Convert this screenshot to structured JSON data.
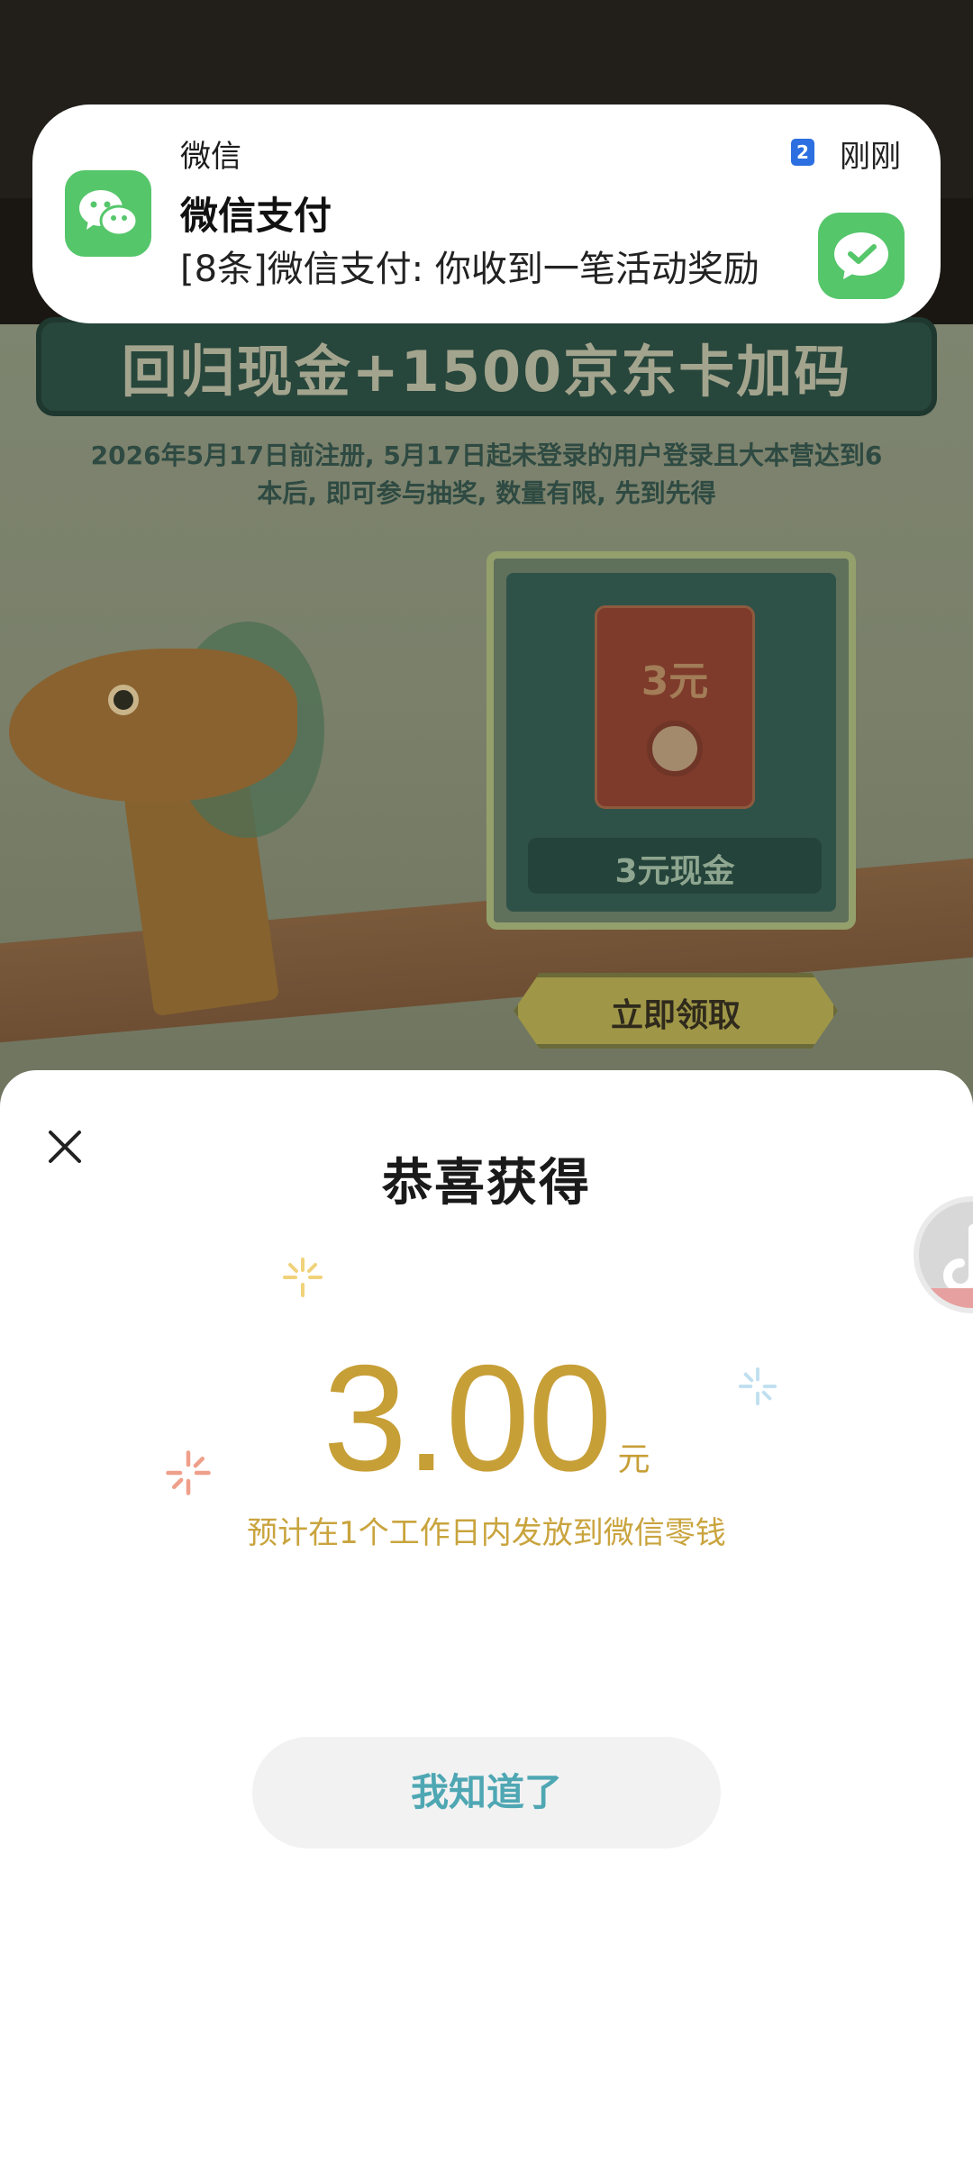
{
  "notification": {
    "app_name": "微信",
    "time": "刚刚",
    "badge": "2",
    "title": "微信支付",
    "body": "[8条]微信支付: 你收到一笔活动奖励"
  },
  "background_page": {
    "banner_title": "回归现金+1500京东卡加码",
    "description": "2026年5月17日前注册, 5月17日起未登录的用户登录且大本营达到6本后, 即可参与抽奖, 数量有限, 先到先得",
    "envelope_value": "3元",
    "prize_label": "3元现金",
    "claim_button": "立即领取"
  },
  "sheet": {
    "title": "恭喜获得",
    "amount": "3.00",
    "unit": "元",
    "note": "预计在1个工作日内发放到微信零钱",
    "ack_button": "我知道了"
  },
  "colors": {
    "wechat_green": "#56c66b",
    "amount_gold": "#c79f37",
    "button_text": "#4ea7b3"
  }
}
